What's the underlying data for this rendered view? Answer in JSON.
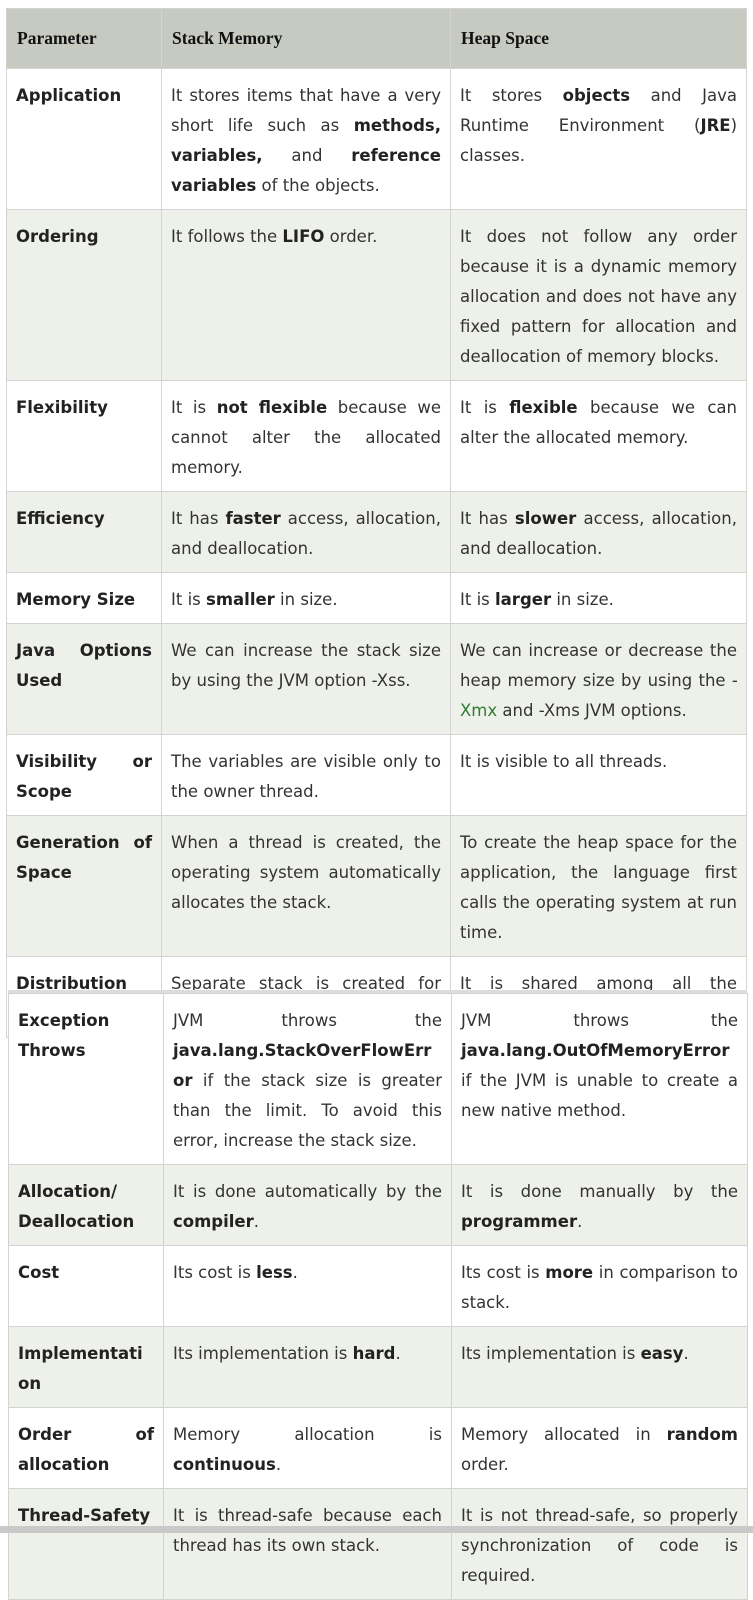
{
  "header": {
    "parameter": "Parameter",
    "stack": "Stack Memory",
    "heap": "Heap Space"
  },
  "rows": [
    {
      "param": "Application",
      "stack": [
        "It stores items that have a very short life such as ",
        {
          "b": "methods,"
        },
        " ",
        {
          "b": "variables,"
        },
        " and ",
        {
          "b": "reference variables"
        },
        " of the objects."
      ],
      "heap": [
        "It stores ",
        {
          "b": "objects"
        },
        " and Java Runtime Environment (",
        {
          "b": "JRE"
        },
        ") classes."
      ]
    },
    {
      "param": "Ordering",
      "stack": [
        "It follows the ",
        {
          "b": "LIFO"
        },
        " order."
      ],
      "heap": [
        "It does not follow any order because it is a dynamic memory allocation and does not have any fixed pattern for allocation and deallocation of memory blocks."
      ]
    },
    {
      "param": "Flexibility",
      "stack": [
        "It is ",
        {
          "b": "not flexible"
        },
        " because we cannot alter the allocated memory."
      ],
      "heap": [
        "It is ",
        {
          "b": "flexible"
        },
        " because we can alter the allocated memory."
      ]
    },
    {
      "param": "Efficiency",
      "stack": [
        "It has ",
        {
          "b": "faster"
        },
        " access, allocation, and deallocation."
      ],
      "heap": [
        "It has ",
        {
          "b": "slower"
        },
        " access, allocation, and deallocation."
      ]
    },
    {
      "param": "Memory Size",
      "stack": [
        "It is ",
        {
          "b": "smaller"
        },
        " in size."
      ],
      "heap": [
        "It is ",
        {
          "b": "larger"
        },
        " in size."
      ]
    },
    {
      "param": "Java Options Used",
      "stack": [
        "We can increase the stack size by using the JVM option -Xss."
      ],
      "heap": [
        "We can increase or decrease the heap memory size by using the -",
        {
          "g": "Xmx"
        },
        " and -Xms JVM options."
      ]
    },
    {
      "param": "Visibility or Scope",
      "stack": [
        "The variables are visible only to the owner thread."
      ],
      "heap": [
        "It is visible to all threads."
      ]
    },
    {
      "param": "Generation of Space",
      "stack": [
        "When a thread is created, the operating system automatically allocates the stack."
      ],
      "heap": [
        "To create the heap space for the application, the language first calls the operating system at run time."
      ]
    },
    {
      "param": "Distribution",
      "stack": [
        "Separate stack is created for each object."
      ],
      "heap": [
        "It is shared among all the threads."
      ]
    }
  ],
  "rows2": [
    {
      "param": "Exception Throws",
      "stack": [
        "JVM throws the ",
        {
          "b": "java.lang.StackOverFlowError"
        },
        " if the stack size is greater than the limit. To avoid this error, increase the stack size."
      ],
      "heap": [
        "JVM throws the ",
        {
          "b": "java.lang.OutOfMemoryError"
        },
        " if the JVM is unable to create a new native method."
      ]
    },
    {
      "param": "Allocation/ Deallocation",
      "stack": [
        "It is done automatically by the ",
        {
          "b": "compiler"
        },
        "."
      ],
      "heap": [
        "It is done manually by the ",
        {
          "b": "programmer"
        },
        "."
      ]
    },
    {
      "param": "Cost",
      "stack": [
        "Its cost is ",
        {
          "b": "less"
        },
        "."
      ],
      "heap": [
        "Its cost is ",
        {
          "b": "more"
        },
        " in comparison to stack."
      ]
    },
    {
      "param": "Implementation",
      "stack": [
        "Its implementation is ",
        {
          "b": "hard"
        },
        "."
      ],
      "heap": [
        "Its implementation is ",
        {
          "b": "easy"
        },
        "."
      ]
    },
    {
      "param": "Order of allocation",
      "stack": [
        "Memory allocation is ",
        {
          "b": "continuous"
        },
        "."
      ],
      "heap": [
        "Memory allocated in ",
        {
          "b": "random"
        },
        " order."
      ]
    },
    {
      "param": "Thread-Safety",
      "stack": [
        "It is thread-safe because each thread has its own stack."
      ],
      "heap": [
        "It is not thread-safe, so properly synchronization of code is required."
      ]
    }
  ]
}
